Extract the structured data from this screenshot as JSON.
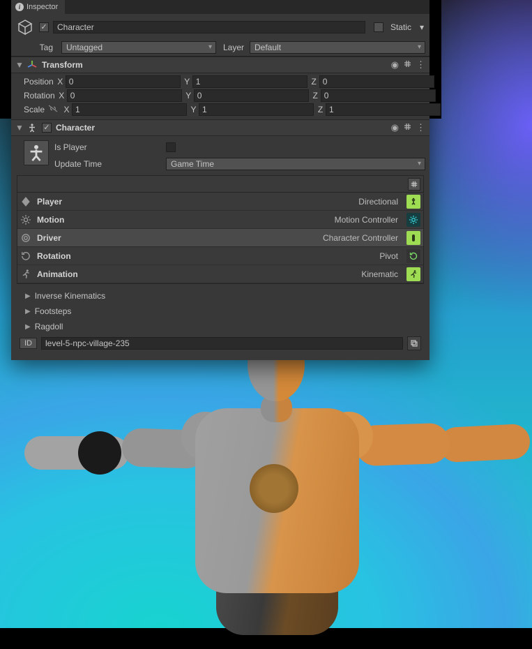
{
  "tab": {
    "title": "Inspector"
  },
  "object": {
    "enabled": true,
    "name": "Character",
    "static_label": "Static",
    "tag_label": "Tag",
    "tag_value": "Untagged",
    "layer_label": "Layer",
    "layer_value": "Default"
  },
  "transform": {
    "title": "Transform",
    "position": {
      "label": "Position",
      "x": "0",
      "y": "1",
      "z": "0"
    },
    "rotation": {
      "label": "Rotation",
      "x": "0",
      "y": "0",
      "z": "0"
    },
    "scale": {
      "label": "Scale",
      "x": "1",
      "y": "1",
      "z": "1"
    }
  },
  "character": {
    "title": "Character",
    "is_player_label": "Is Player",
    "is_player_value": false,
    "update_time_label": "Update Time",
    "update_time_value": "Game Time",
    "config": [
      {
        "name": "Player",
        "value": "Directional",
        "tile": "green",
        "icon": "diamond"
      },
      {
        "name": "Motion",
        "value": "Motion Controller",
        "tile": "teal",
        "icon": "gear"
      },
      {
        "name": "Driver",
        "value": "Character Controller",
        "tile": "green",
        "icon": "capsule",
        "selected": true
      },
      {
        "name": "Rotation",
        "value": "Pivot",
        "tile": "dark",
        "icon": "rotate"
      },
      {
        "name": "Animation",
        "value": "Kinematic",
        "tile": "green",
        "icon": "run"
      }
    ],
    "foldouts": [
      "Inverse Kinematics",
      "Footsteps",
      "Ragdoll"
    ],
    "id_label": "ID",
    "id_value": "level-5-npc-village-235"
  }
}
